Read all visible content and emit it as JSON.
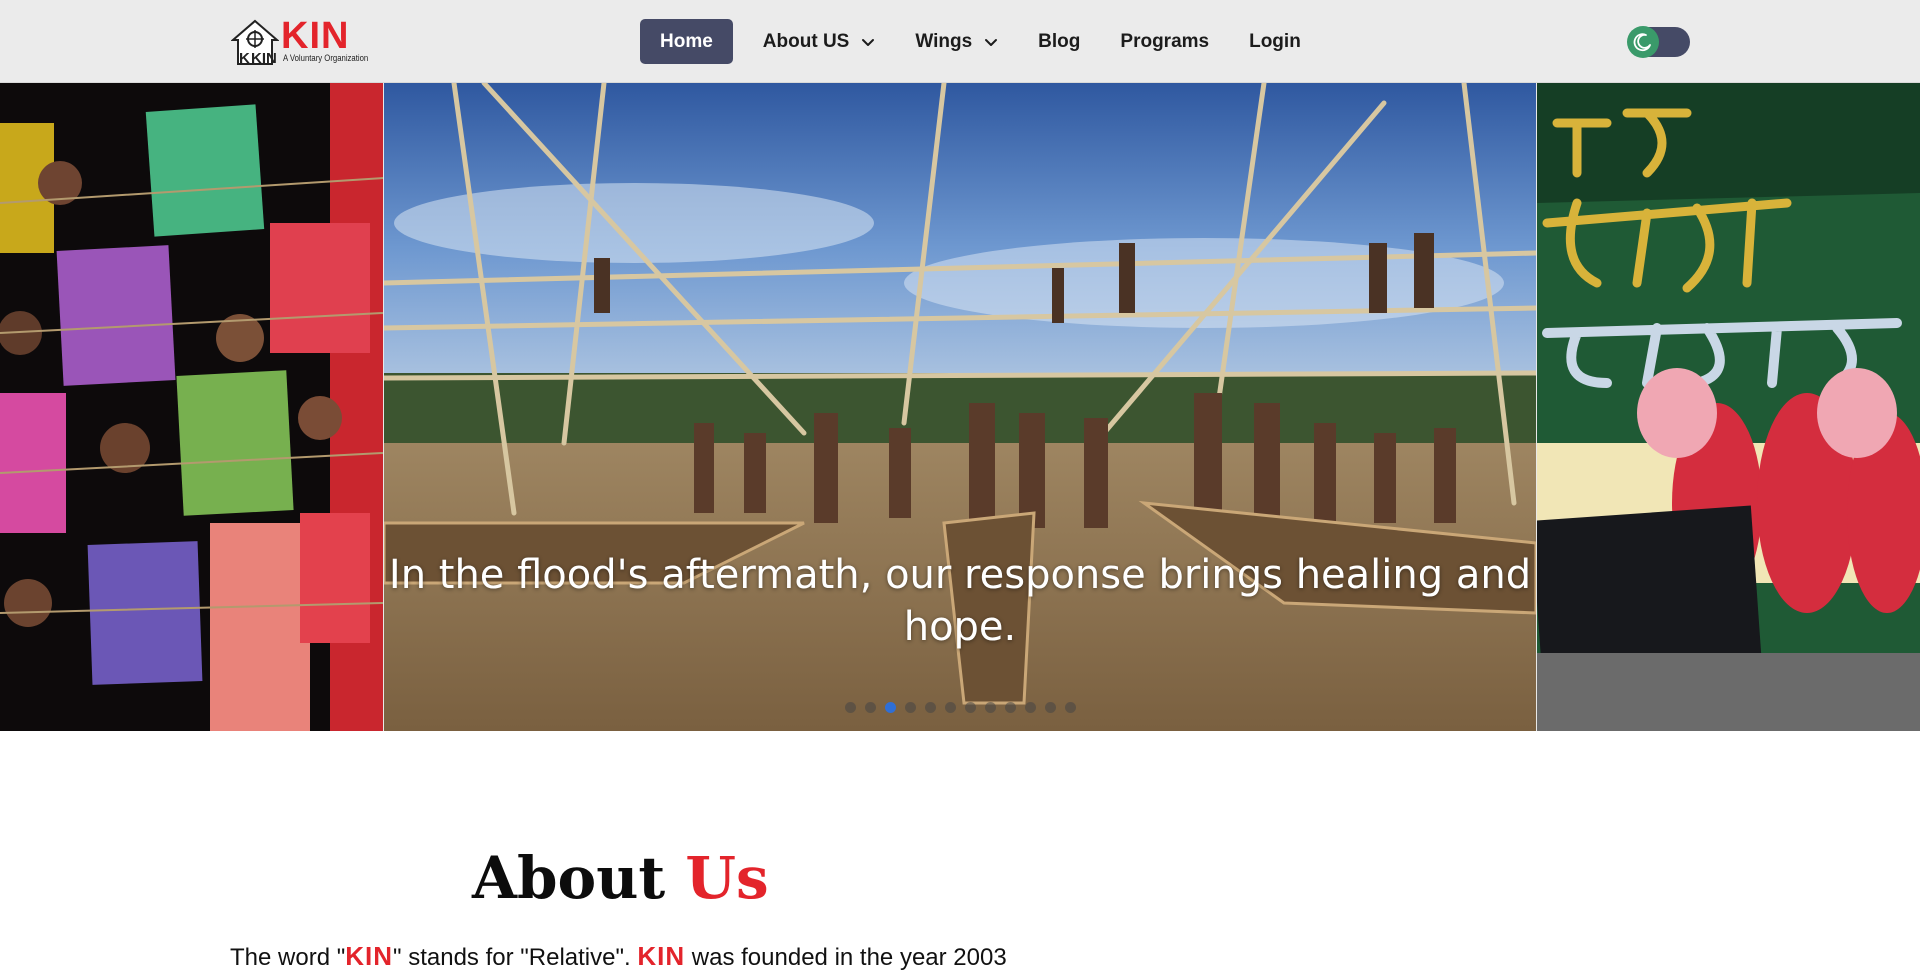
{
  "brand": {
    "name": "KIN",
    "tagline": "A Voluntary Organization",
    "mark_text": "KIN",
    "accent_color": "#e3242b"
  },
  "nav": {
    "items": [
      {
        "label": "Home",
        "active": true,
        "dropdown": false
      },
      {
        "label": "About US",
        "active": false,
        "dropdown": true
      },
      {
        "label": "Wings",
        "active": false,
        "dropdown": true
      },
      {
        "label": "Blog",
        "active": false,
        "dropdown": false
      },
      {
        "label": "Programs",
        "active": false,
        "dropdown": false
      },
      {
        "label": "Login",
        "active": false,
        "dropdown": false
      }
    ],
    "active_color": "#454a66"
  },
  "theme_toggle": {
    "icon": "moon-icon",
    "knob_color": "#3a9a6a",
    "track_color": "#454a66"
  },
  "hero": {
    "caption": "In the flood's aftermath, our response brings healing and hope.",
    "dot_count": 12,
    "active_dot": 3,
    "active_dot_color": "#2f6fd6"
  },
  "about": {
    "title_word": "About",
    "title_accent": "Us",
    "text_prefix": "The word \"",
    "kin_1": "KIN",
    "text_mid": "\" stands for \"Relative\". ",
    "kin_2": "KIN",
    "text_suffix": " was founded in the year 2003"
  }
}
